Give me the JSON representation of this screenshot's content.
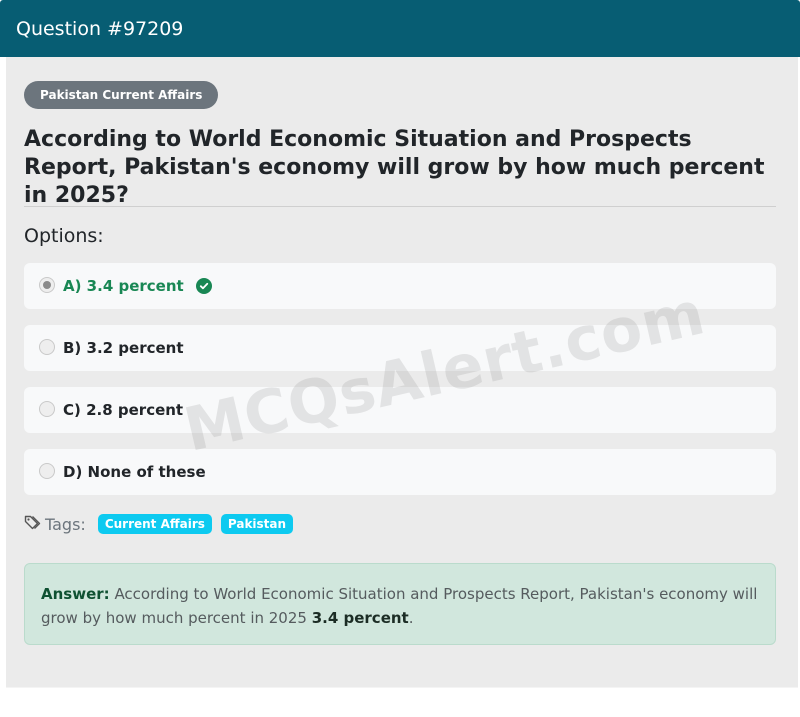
{
  "header": {
    "title": "Question #97209"
  },
  "category": "Pakistan Current Affairs",
  "question": "According to World Economic Situation and Prospects Report, Pakistan's economy will grow by how much percent in 2025?",
  "options_label": "Options:",
  "options": [
    {
      "label": "A) 3.4 percent",
      "selected": true,
      "correct": true
    },
    {
      "label": "B) 3.2 percent",
      "selected": false,
      "correct": false
    },
    {
      "label": "C) 2.8 percent",
      "selected": false,
      "correct": false
    },
    {
      "label": "D) None of these",
      "selected": false,
      "correct": false
    }
  ],
  "tags_label": "Tags:",
  "tags": [
    "Current Affairs",
    "Pakistan"
  ],
  "answer": {
    "label": "Answer:",
    "text": "According to World Economic Situation and Prospects Report, Pakistan's economy will grow by how much percent in 2025",
    "value": "3.4 percent",
    "end": "."
  },
  "watermark": "MCQsAlert.com",
  "colors": {
    "header_bg": "#075d73",
    "correct_green": "#198754",
    "tag_bg": "#0dcaf0",
    "answer_bg": "#d1e7dd",
    "badge_bg": "#6c757d"
  },
  "icons": {
    "correct": "check-circle-icon",
    "tags": "tags-icon"
  }
}
